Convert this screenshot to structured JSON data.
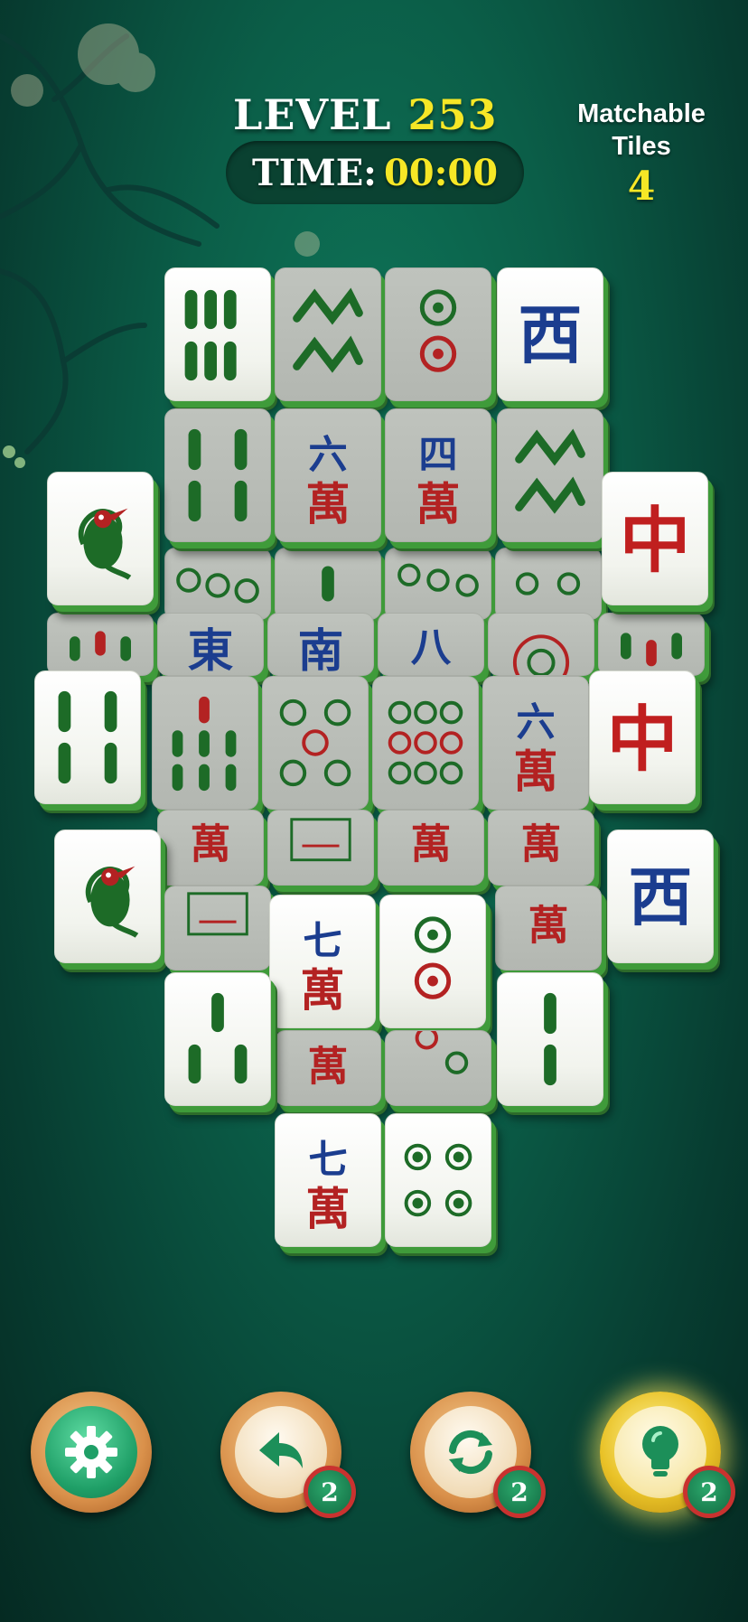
{
  "hud": {
    "level_label": "LEVEL",
    "level_number": "253",
    "time_label": "TIME:",
    "time_value": "00:00",
    "matchable_label": "Matchable Tiles",
    "matchable_count": "4"
  },
  "tiles": [
    {
      "id": "t1",
      "face": "bamboo-6",
      "state": "free"
    },
    {
      "id": "t2",
      "face": "bamboo-4-chain",
      "state": "blocked"
    },
    {
      "id": "t3",
      "face": "circle-2",
      "state": "blocked"
    },
    {
      "id": "t4",
      "face": "west",
      "state": "free",
      "text": "西"
    },
    {
      "id": "t5",
      "face": "bamboo-4",
      "state": "blocked"
    },
    {
      "id": "t6",
      "face": "char-6",
      "state": "blocked",
      "text": "六",
      "sub": "萬"
    },
    {
      "id": "t7",
      "face": "char-4",
      "state": "blocked",
      "text": "四",
      "sub": "萬"
    },
    {
      "id": "t8",
      "face": "bamboo-4-chain",
      "state": "blocked"
    },
    {
      "id": "t9",
      "face": "bamboo-1-bird",
      "state": "free"
    },
    {
      "id": "t10",
      "face": "red-dragon",
      "state": "free",
      "text": "中"
    },
    {
      "id": "t11",
      "face": "bamboo-4",
      "state": "free"
    },
    {
      "id": "t12",
      "face": "bamboo-7",
      "state": "blocked"
    },
    {
      "id": "t13",
      "face": "circle-5",
      "state": "blocked"
    },
    {
      "id": "t14",
      "face": "circle-9",
      "state": "blocked"
    },
    {
      "id": "t15",
      "face": "char-6",
      "state": "blocked",
      "text": "六",
      "sub": "萬"
    },
    {
      "id": "t16",
      "face": "red-dragon",
      "state": "free",
      "text": "中"
    },
    {
      "id": "t17",
      "face": "bamboo-1-bird",
      "state": "free"
    },
    {
      "id": "t18",
      "face": "west",
      "state": "free",
      "text": "西"
    },
    {
      "id": "t19",
      "face": "char-7",
      "state": "free",
      "text": "七",
      "sub": "萬"
    },
    {
      "id": "t20",
      "face": "circle-2",
      "state": "free"
    },
    {
      "id": "t21",
      "face": "bamboo-3",
      "state": "free"
    },
    {
      "id": "t22",
      "face": "bamboo-2",
      "state": "free"
    },
    {
      "id": "t23",
      "face": "char-7",
      "state": "free",
      "text": "七",
      "sub": "萬"
    },
    {
      "id": "t24",
      "face": "circle-4",
      "state": "free"
    }
  ],
  "partial_chars": {
    "wan": "萬",
    "east": "東",
    "south": "南",
    "eight": "八"
  },
  "buttons": {
    "settings_icon": "gear-icon",
    "undo_icon": "undo-arrow-icon",
    "undo_count": "2",
    "shuffle_icon": "shuffle-icon",
    "shuffle_count": "2",
    "hint_icon": "lightbulb-icon",
    "hint_count": "2"
  }
}
